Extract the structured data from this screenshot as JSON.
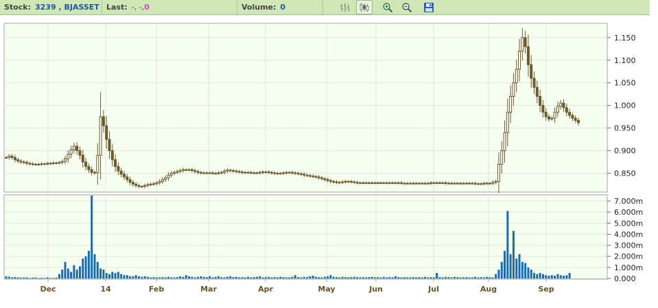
{
  "toolbar": {
    "stock_label": "Stock:",
    "stock_value": "3239 , BJASSET",
    "last_label": "Last:",
    "last_value": "-, -, ",
    "last_change": "0",
    "volume_label": "Volume:",
    "volume_value": "0",
    "icons": [
      "ohlc-bar-icon",
      "candlestick-icon",
      "zoom-in-icon",
      "zoom-out-icon",
      "save-icon"
    ]
  },
  "colors": {
    "candle": "#6b5a2e",
    "volume": "#1a6ab0",
    "plot_bg": "#f7fff0",
    "grid": "#dde6d6",
    "axis_text": "#6b5226"
  },
  "chart_data": {
    "type": "candlestick",
    "x_ticks": [
      "Dec",
      "14",
      "Feb",
      "Mar",
      "Apr",
      "May",
      "Jun",
      "Jul",
      "Aug",
      "Sep"
    ],
    "price_ticks": [
      "1.150",
      "1.100",
      "1.050",
      "1.000",
      "0.950",
      "0.900",
      "0.850"
    ],
    "volume_ticks": [
      "7.000m",
      "6.000m",
      "5.000m",
      "4.000m",
      "3.000m",
      "2.000m",
      "1.000m",
      "0.000"
    ],
    "price_ylim": [
      0.81,
      1.18
    ],
    "volume_ylim": [
      0,
      7.5
    ],
    "volume_unit": "m",
    "grid": true,
    "series_price": [
      0.885,
      0.888,
      0.885,
      0.88,
      0.877,
      0.875,
      0.874,
      0.872,
      0.871,
      0.87,
      0.87,
      0.87,
      0.871,
      0.871,
      0.872,
      0.872,
      0.873,
      0.873,
      0.874,
      0.876,
      0.882,
      0.892,
      0.902,
      0.91,
      0.9,
      0.89,
      0.875,
      0.865,
      0.858,
      0.852,
      0.851,
      0.89,
      0.975,
      0.955,
      0.925,
      0.9,
      0.88,
      0.865,
      0.855,
      0.848,
      0.842,
      0.836,
      0.83,
      0.826,
      0.823,
      0.821,
      0.821,
      0.823,
      0.825,
      0.826,
      0.827,
      0.829,
      0.832,
      0.836,
      0.84,
      0.846,
      0.85,
      0.852,
      0.854,
      0.856,
      0.858,
      0.858,
      0.858,
      0.856,
      0.854,
      0.852,
      0.851,
      0.851,
      0.851,
      0.851,
      0.85,
      0.85,
      0.851,
      0.852,
      0.855,
      0.857,
      0.856,
      0.855,
      0.854,
      0.853,
      0.852,
      0.852,
      0.852,
      0.851,
      0.851,
      0.851,
      0.852,
      0.853,
      0.853,
      0.852,
      0.851,
      0.85,
      0.85,
      0.85,
      0.851,
      0.852,
      0.852,
      0.851,
      0.85,
      0.849,
      0.848,
      0.846,
      0.845,
      0.844,
      0.843,
      0.842,
      0.84,
      0.838,
      0.836,
      0.834,
      0.832,
      0.831,
      0.83,
      0.83,
      0.831,
      0.832,
      0.832,
      0.831,
      0.83,
      0.829,
      0.829,
      0.829,
      0.829,
      0.829,
      0.829,
      0.829,
      0.829,
      0.829,
      0.829,
      0.829,
      0.829,
      0.829,
      0.829,
      0.829,
      0.828,
      0.828,
      0.828,
      0.828,
      0.828,
      0.828,
      0.828,
      0.828,
      0.828,
      0.828,
      0.829,
      0.829,
      0.829,
      0.829,
      0.829,
      0.828,
      0.828,
      0.828,
      0.828,
      0.828,
      0.828,
      0.828,
      0.828,
      0.828,
      0.828,
      0.827,
      0.827,
      0.827,
      0.828,
      0.828,
      0.828,
      0.83,
      0.832,
      0.87,
      0.9,
      0.94,
      0.985,
      1.02,
      1.05,
      1.08,
      1.12,
      1.15,
      1.13,
      1.09,
      1.06,
      1.04,
      1.02,
      1.0,
      0.985,
      0.975,
      0.97,
      0.972,
      0.985,
      0.998,
      1.005,
      0.995,
      0.985,
      0.978,
      0.972,
      0.967,
      0.962
    ],
    "series_volume": [
      0.2,
      0.15,
      0.1,
      0.12,
      0.1,
      0.08,
      0.1,
      0.1,
      0.05,
      0.08,
      0.1,
      0.05,
      0.06,
      0.05,
      0.1,
      0.05,
      0.05,
      0.08,
      0.4,
      0.8,
      1.5,
      0.9,
      0.6,
      1.2,
      0.8,
      1.1,
      1.8,
      2.0,
      2.5,
      7.5,
      2.2,
      1.5,
      0.9,
      0.8,
      0.5,
      0.4,
      0.6,
      0.5,
      0.6,
      0.4,
      0.3,
      0.3,
      0.2,
      0.2,
      0.3,
      0.2,
      0.15,
      0.2,
      0.15,
      0.1,
      0.12,
      0.1,
      0.1,
      0.12,
      0.1,
      0.15,
      0.1,
      0.1,
      0.12,
      0.2,
      0.15,
      0.3,
      0.2,
      0.15,
      0.1,
      0.15,
      0.2,
      0.15,
      0.12,
      0.2,
      0.1,
      0.15,
      0.2,
      0.12,
      0.1,
      0.15,
      0.2,
      0.12,
      0.15,
      0.1,
      0.12,
      0.1,
      0.15,
      0.1,
      0.12,
      0.15,
      0.2,
      0.1,
      0.12,
      0.15,
      0.1,
      0.12,
      0.1,
      0.15,
      0.12,
      0.1,
      0.1,
      0.15,
      0.3,
      0.12,
      0.1,
      0.15,
      0.12,
      0.2,
      0.25,
      0.15,
      0.12,
      0.1,
      0.15,
      0.2,
      0.3,
      0.15,
      0.12,
      0.1,
      0.15,
      0.12,
      0.1,
      0.12,
      0.15,
      0.12,
      0.1,
      0.12,
      0.1,
      0.12,
      0.15,
      0.1,
      0.12,
      0.1,
      0.15,
      0.1,
      0.12,
      0.1,
      0.2,
      0.12,
      0.1,
      0.12,
      0.1,
      0.1,
      0.12,
      0.1,
      0.12,
      0.1,
      0.15,
      0.1,
      0.12,
      0.1,
      0.5,
      0.12,
      0.1,
      0.15,
      0.12,
      0.1,
      0.15,
      0.12,
      0.1,
      0.1,
      0.12,
      0.1,
      0.1,
      0.15,
      0.1,
      0.12,
      0.1,
      0.15,
      0.12,
      0.1,
      0.4,
      0.8,
      1.5,
      2.5,
      6.1,
      2.2,
      4.3,
      1.8,
      2.2,
      1.5,
      1.4,
      1.0,
      0.8,
      0.5,
      0.4,
      0.5,
      0.4,
      0.3,
      0.25,
      0.3,
      0.25,
      0.4,
      0.3,
      0.25,
      0.3,
      0.5
    ]
  }
}
